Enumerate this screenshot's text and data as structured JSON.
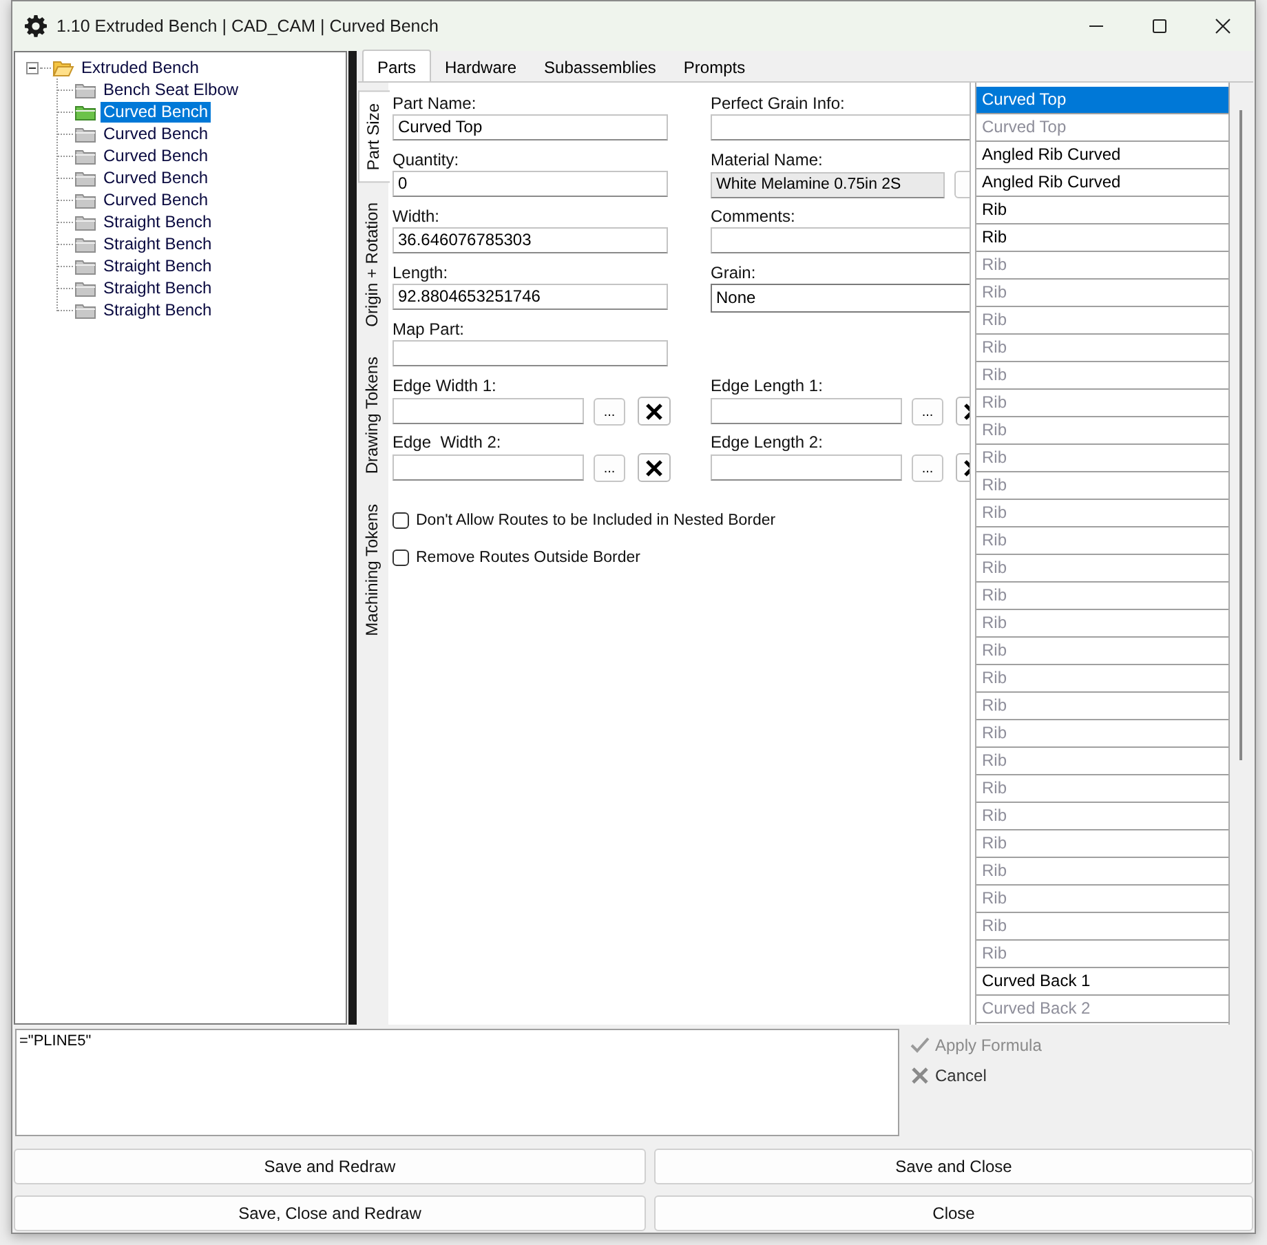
{
  "window": {
    "title": "1.10 Extruded Bench | CAD_CAM | Curved Bench"
  },
  "tree": {
    "label": "Extruded Bench",
    "expanded": true,
    "selected": false,
    "children": [
      {
        "label": "Bench Seat Elbow",
        "selected": false
      },
      {
        "label": "Curved Bench",
        "selected": true
      },
      {
        "label": "Curved Bench",
        "selected": false
      },
      {
        "label": "Curved Bench",
        "selected": false
      },
      {
        "label": "Curved Bench",
        "selected": false
      },
      {
        "label": "Curved Bench",
        "selected": false
      },
      {
        "label": "Straight Bench",
        "selected": false
      },
      {
        "label": "Straight Bench",
        "selected": false
      },
      {
        "label": "Straight Bench",
        "selected": false
      },
      {
        "label": "Straight Bench",
        "selected": false
      },
      {
        "label": "Straight Bench",
        "selected": false
      }
    ]
  },
  "tabs": [
    {
      "label": "Parts",
      "selected": true
    },
    {
      "label": "Hardware",
      "selected": false
    },
    {
      "label": "Subassemblies",
      "selected": false
    },
    {
      "label": "Prompts",
      "selected": false
    }
  ],
  "side_tabs": [
    {
      "label": "Part Size",
      "selected": true
    },
    {
      "label": "Origin + Rotation",
      "selected": false
    },
    {
      "label": "Drawing Tokens",
      "selected": false
    },
    {
      "label": "Machining Tokens",
      "selected": false
    }
  ],
  "form": {
    "rows": [
      [
        {
          "label": "Part Name:",
          "kind": "text",
          "value": "Curved Top"
        },
        {
          "label": "Perfect Grain Info:",
          "kind": "text"
        }
      ],
      [
        {
          "label": "Quantity:",
          "kind": "text",
          "value": "0"
        },
        {
          "label": "Material Name:",
          "kind": "picker",
          "value": "White Melamine 0.75in 2S"
        }
      ],
      [
        {
          "label": "Width:",
          "kind": "text",
          "value": "36.646076785303"
        },
        {
          "label": "Comments:",
          "kind": "text"
        }
      ],
      [
        {
          "label": "Length:",
          "kind": "text",
          "value": "92.8804653251746"
        },
        {
          "label": "Grain:",
          "kind": "select",
          "value": "None"
        }
      ],
      [
        {
          "label": "Map Part:",
          "kind": "text"
        }
      ],
      [
        {
          "label": "Edge Width 1:",
          "kind": "edge",
          "browse": "..."
        },
        {
          "label": "Edge Length 1:",
          "kind": "edge",
          "browse": "..."
        }
      ],
      [
        {
          "label": "Edge  Width 2:",
          "kind": "edge",
          "browse": "..."
        },
        {
          "label": "Edge Length 2:",
          "kind": "edge",
          "browse": "..."
        }
      ]
    ],
    "checkboxes": [
      {
        "label": "Don't Allow Routes to be Included in Nested Border",
        "checked": false
      },
      {
        "label": "Remove Routes Outside Border",
        "checked": false
      }
    ]
  },
  "parts_list": [
    {
      "label": "Curved Top",
      "selected": true,
      "dimmed": false
    },
    {
      "label": "Curved Top",
      "selected": false,
      "dimmed": true
    },
    {
      "label": "Angled Rib Curved",
      "selected": false,
      "dimmed": false
    },
    {
      "label": "Angled Rib Curved",
      "selected": false,
      "dimmed": false
    },
    {
      "label": "Rib",
      "selected": false,
      "dimmed": false
    },
    {
      "label": "Rib",
      "selected": false,
      "dimmed": false
    },
    {
      "label": "Rib",
      "selected": false,
      "dimmed": true
    },
    {
      "label": "Rib",
      "selected": false,
      "dimmed": true
    },
    {
      "label": "Rib",
      "selected": false,
      "dimmed": true
    },
    {
      "label": "Rib",
      "selected": false,
      "dimmed": true
    },
    {
      "label": "Rib",
      "selected": false,
      "dimmed": true
    },
    {
      "label": "Rib",
      "selected": false,
      "dimmed": true
    },
    {
      "label": "Rib",
      "selected": false,
      "dimmed": true
    },
    {
      "label": "Rib",
      "selected": false,
      "dimmed": true
    },
    {
      "label": "Rib",
      "selected": false,
      "dimmed": true
    },
    {
      "label": "Rib",
      "selected": false,
      "dimmed": true
    },
    {
      "label": "Rib",
      "selected": false,
      "dimmed": true
    },
    {
      "label": "Rib",
      "selected": false,
      "dimmed": true
    },
    {
      "label": "Rib",
      "selected": false,
      "dimmed": true
    },
    {
      "label": "Rib",
      "selected": false,
      "dimmed": true
    },
    {
      "label": "Rib",
      "selected": false,
      "dimmed": true
    },
    {
      "label": "Rib",
      "selected": false,
      "dimmed": true
    },
    {
      "label": "Rib",
      "selected": false,
      "dimmed": true
    },
    {
      "label": "Rib",
      "selected": false,
      "dimmed": true
    },
    {
      "label": "Rib",
      "selected": false,
      "dimmed": true
    },
    {
      "label": "Rib",
      "selected": false,
      "dimmed": true
    },
    {
      "label": "Rib",
      "selected": false,
      "dimmed": true
    },
    {
      "label": "Rib",
      "selected": false,
      "dimmed": true
    },
    {
      "label": "Rib",
      "selected": false,
      "dimmed": true
    },
    {
      "label": "Rib",
      "selected": false,
      "dimmed": true
    },
    {
      "label": "Rib",
      "selected": false,
      "dimmed": true
    },
    {
      "label": "Rib",
      "selected": false,
      "dimmed": true
    },
    {
      "label": "Curved Back 1",
      "selected": false,
      "dimmed": false
    },
    {
      "label": "Curved Back 2",
      "selected": false,
      "dimmed": true
    }
  ],
  "formula": {
    "value": "=\"PLINE5\"",
    "actions": [
      {
        "label": "Apply Formula",
        "kind": "apply",
        "disabled": true
      },
      {
        "label": "Cancel",
        "kind": "cancel",
        "disabled": false
      }
    ]
  },
  "buttons": [
    "Save and Redraw",
    "Save and Close",
    "Save, Close and Redraw",
    "Close"
  ]
}
